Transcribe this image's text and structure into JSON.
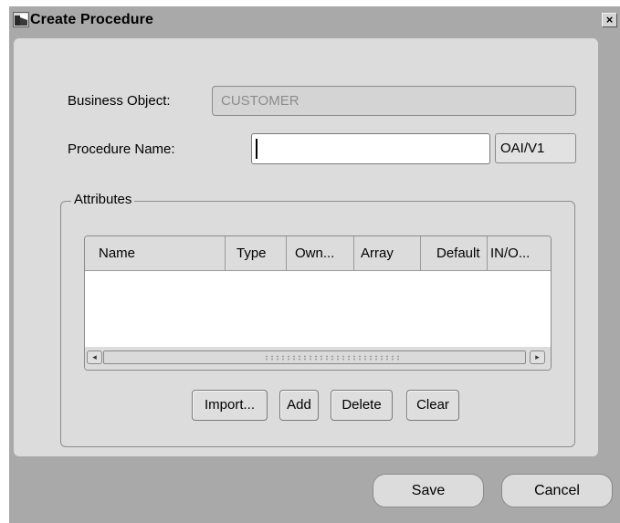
{
  "window": {
    "title": "Create Procedure",
    "close_glyph": "×"
  },
  "form": {
    "business_object_label": "Business Object:",
    "business_object_value": "CUSTOMER",
    "procedure_name_label": "Procedure Name:",
    "procedure_name_value": "",
    "suffix_value": "OAI/V1"
  },
  "attributes": {
    "group_label": "Attributes",
    "columns": [
      "Name",
      "Type",
      "Own...",
      "Array",
      "Default",
      "IN/O..."
    ],
    "rows": [],
    "scroll_left_glyph": "◂",
    "scroll_right_glyph": "▸",
    "buttons": {
      "import": "Import...",
      "add": "Add",
      "delete": "Delete",
      "clear": "Clear"
    }
  },
  "footer": {
    "save": "Save",
    "cancel": "Cancel"
  },
  "icons": {
    "window_icon": "app-window-icon",
    "close_icon": "close-icon"
  }
}
